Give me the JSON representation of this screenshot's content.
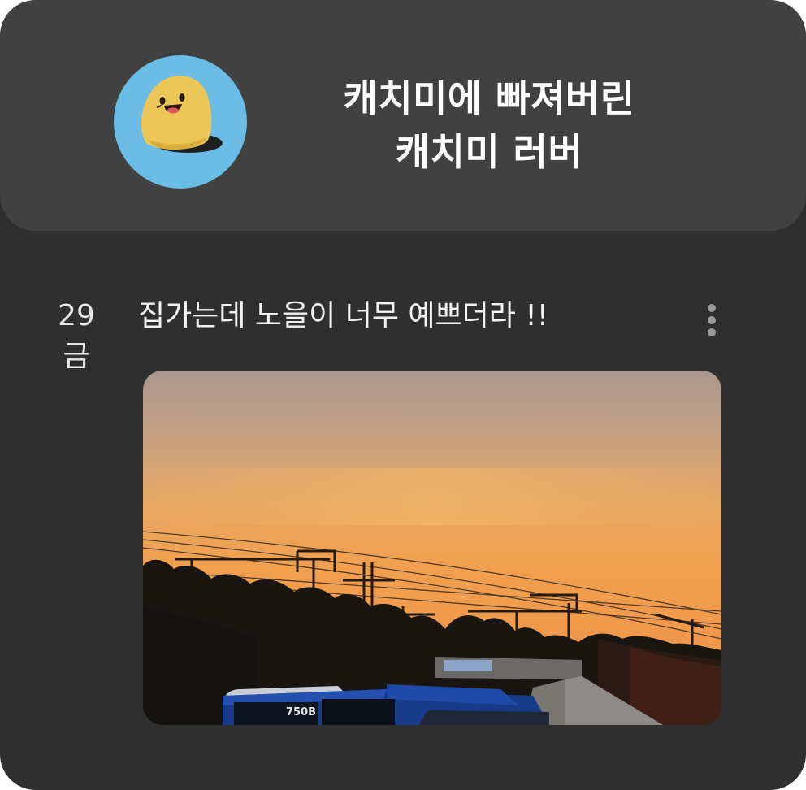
{
  "profile": {
    "avatar_icon": "yellow-blob-character-icon",
    "name_line1": "캐치미에 빠져버린",
    "name_line2": "캐치미 러버",
    "avatar_bg": "#6bbde6"
  },
  "entry": {
    "day": "29",
    "weekday": "금",
    "text": "집가는데 노을이 너무 예쁘더라 !!",
    "more_icon": "vertical-dots-more-icon",
    "photo": {
      "description_icon": "sunset-photo",
      "bus_number": "750B"
    }
  },
  "colors": {
    "card_bg": "#2f2f2f",
    "header_bg": "#414141",
    "text": "#f2f2f2"
  }
}
